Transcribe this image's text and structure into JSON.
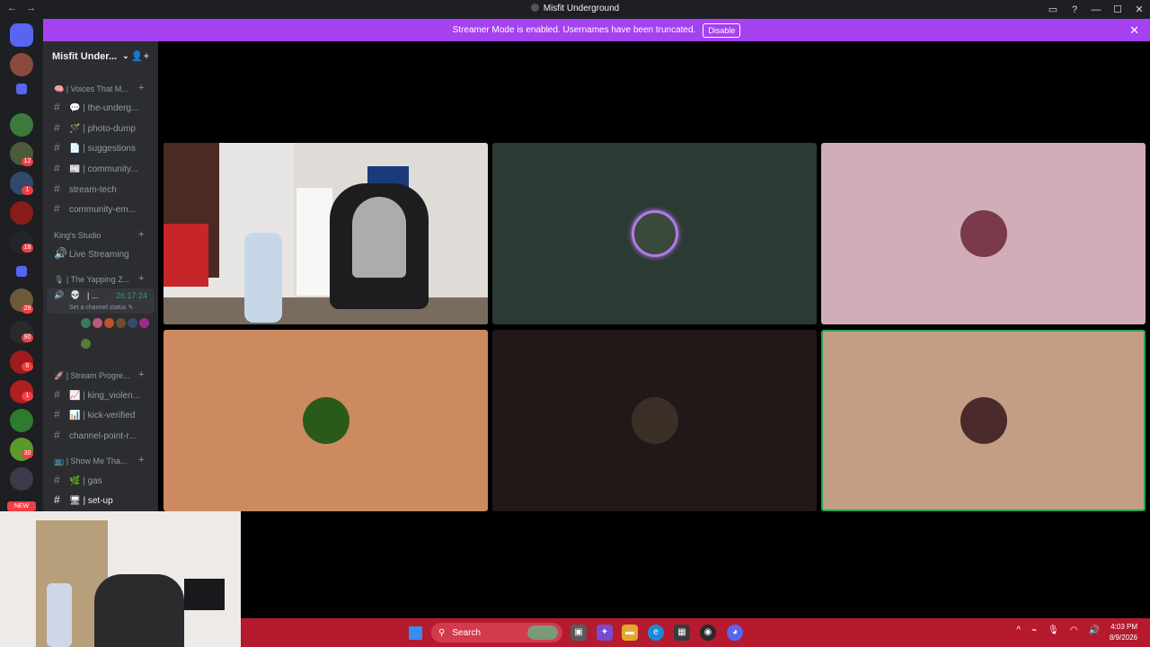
{
  "window": {
    "title": "Misfit Underground",
    "nav": [
      "←",
      "→"
    ],
    "controls": [
      "▭",
      "?",
      "—",
      "☐",
      "✕"
    ]
  },
  "banner": {
    "text": "Streamer Mode is enabled. Usernames have been truncated.",
    "button": "Disable",
    "close": "✕"
  },
  "sidebar": {
    "server_name": "Misfit Under...",
    "categories": [
      {
        "label": "🧠 | Voices That M...",
        "plus": "+"
      },
      {
        "label": "King's Studio",
        "plus": "+"
      },
      {
        "label": "🎙 | The Yapping Z...",
        "plus": "+"
      },
      {
        "label": "🚀 | Stream Progre...",
        "plus": "+"
      },
      {
        "label": "📺 | Show Me Tha...",
        "plus": "+"
      }
    ],
    "channels": [
      {
        "hash": "#",
        "label": "💬 | the-underg..."
      },
      {
        "hash": "#",
        "label": "🪄 | photo-dump"
      },
      {
        "hash": "#",
        "label": "📄 | suggestions"
      },
      {
        "hash": "#",
        "label": "📰 | community..."
      },
      {
        "hash": "#",
        "label": "stream-tech"
      },
      {
        "hash": "#",
        "label": "community-em..."
      },
      {
        "hash": "🔊",
        "label": "Live Streaming"
      },
      {
        "hash": "#",
        "label": "📈 | king_violen..."
      },
      {
        "hash": "#",
        "label": "📊 | kick-verified"
      },
      {
        "hash": "#",
        "label": "channel-point-r..."
      },
      {
        "hash": "#",
        "label": "🌿 | gas"
      },
      {
        "hash": "#",
        "label": "🖥 | set-up"
      }
    ],
    "voice_user": {
      "name": "| ...",
      "timer": "26:17:24",
      "status": "Set a channel status ✎"
    }
  },
  "rail": {
    "badges": [
      "12",
      "1",
      "18",
      "28",
      "90",
      "6",
      "1",
      "30"
    ],
    "new_label": "NEW"
  },
  "taskbar": {
    "search": "Search",
    "time": "4:03 PM",
    "date": "8/9/2026"
  },
  "colors": {
    "accent": "#a541f0",
    "speaking": "#23a559",
    "taskbar": "#b51a2e"
  }
}
